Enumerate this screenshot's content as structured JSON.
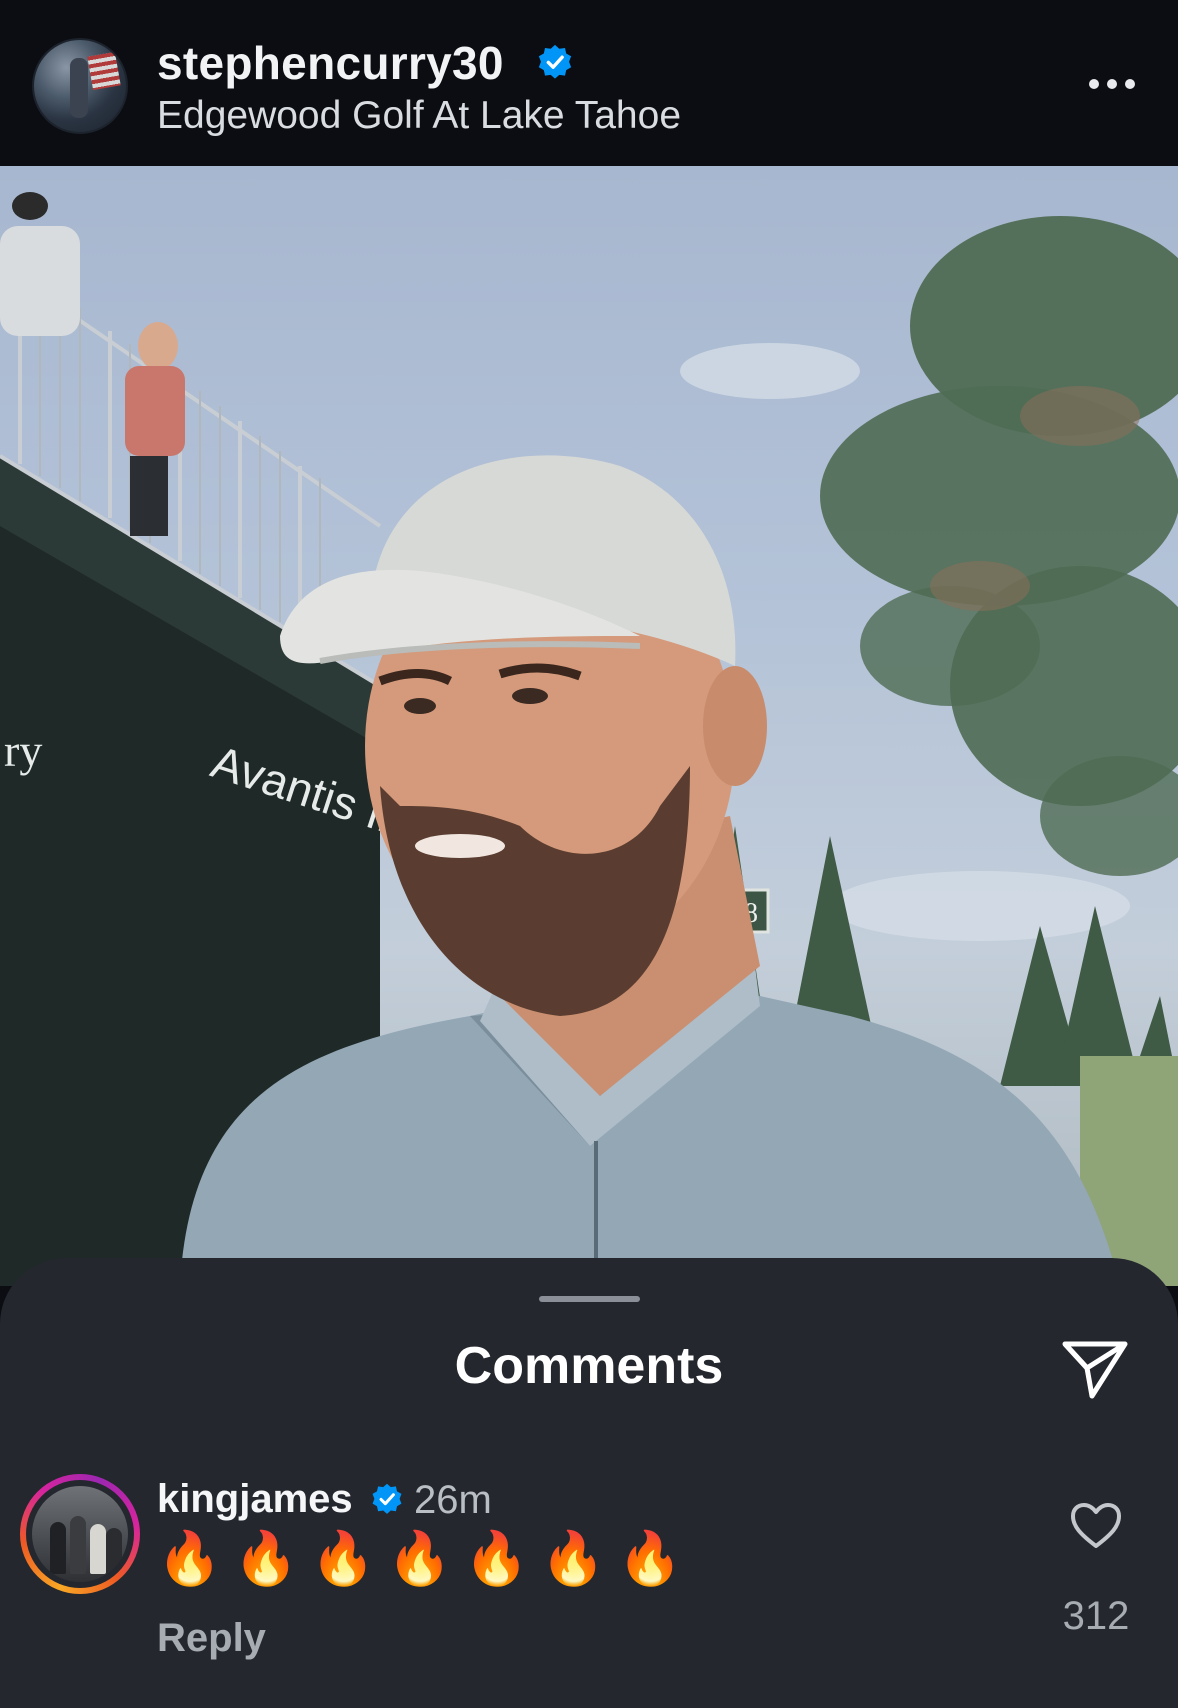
{
  "post": {
    "username": "stephencurry30",
    "verified": true,
    "location": "Edgewood Golf At Lake Tahoe",
    "more_icon": "more-horizontal-icon"
  },
  "photo": {
    "banner_text": "Avantis Investors",
    "banner_partial": "ry",
    "hole_sign": "18"
  },
  "comments_sheet": {
    "title": "Comments",
    "share_icon": "paper-plane-icon",
    "comments": [
      {
        "username": "kingjames",
        "verified": true,
        "time": "26m",
        "text": "🔥🔥🔥🔥🔥🔥🔥",
        "reply_label": "Reply",
        "likes": "312"
      }
    ]
  },
  "colors": {
    "verified_blue": "#0095f6",
    "sheet_bg": "#24272e",
    "header_bg": "#0b0d12"
  }
}
